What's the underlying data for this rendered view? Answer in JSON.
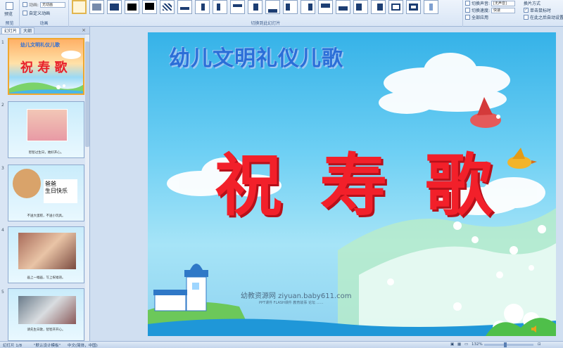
{
  "ribbon": {
    "preview_group": {
      "label": "预览",
      "button": "预览"
    },
    "animation_group": {
      "label": "动画",
      "effect_value": "无动画",
      "custom_label": "自定义动画"
    },
    "transition_group": {
      "label": "切换到此幻灯片"
    },
    "sound_label": "切换声音:",
    "sound_value": "[无声音]",
    "speed_label": "切换速度:",
    "speed_value": "快速",
    "apply_all_label": "全部应用",
    "advance_label": "换片方式",
    "on_click_label": "单击鼠标时",
    "auto_label": "在此之后自动设置"
  },
  "panel": {
    "tabs": [
      "幻灯片",
      "大纲"
    ],
    "close": "×",
    "slides": [
      {
        "num": "1",
        "caption": ""
      },
      {
        "num": "2",
        "caption": "智智过生日，她好开心。"
      },
      {
        "num": "3",
        "caption": "不送大蛋糕，不送小玩具。"
      },
      {
        "num": "4",
        "caption": "画上一幅画，写上祝福语。"
      },
      {
        "num": "5",
        "caption": "请先生日歌，智智开开心。"
      }
    ],
    "thumb1_title": "幼儿文明礼仪儿歌",
    "thumb1_big": "祝 寿 歌",
    "thumb3_text": "爸爸\n生日快乐"
  },
  "slide": {
    "title": "幼儿文明礼仪儿歌",
    "heading": "祝 寿 歌",
    "watermark": "幼教资源网 ziyuan.baby611.com",
    "watermark_sub": "PPT课件  FLASH课件  教育故事  论坛 ……"
  },
  "status": {
    "slide_info": "幻灯片 1/8",
    "theme": "\"默认设计模板\"",
    "language": "中文(简体，中国)",
    "zoom": "132%"
  }
}
